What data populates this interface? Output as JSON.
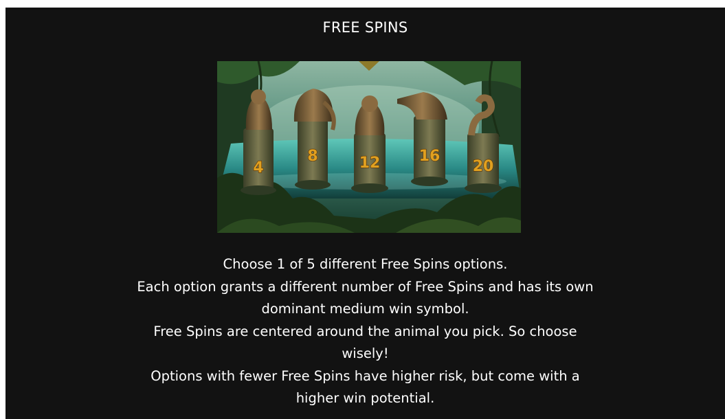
{
  "title": "FREE SPINS",
  "scene": {
    "pillars": [
      {
        "animal": "bear-statue",
        "spins": "4"
      },
      {
        "animal": "elephant-statue",
        "spins": "8"
      },
      {
        "animal": "bear-statue",
        "spins": "12"
      },
      {
        "animal": "crocodile-statue",
        "spins": "16"
      },
      {
        "animal": "snake-statue",
        "spins": "20"
      }
    ]
  },
  "description": [
    "Choose 1 of 5 different Free Spins options.",
    "Each option grants a different number of Free Spins and has its own",
    "dominant medium win symbol.",
    "Free Spins are centered around the animal you pick. So choose",
    "wisely!",
    "Options with fewer Free Spins have higher risk, but come with a",
    "higher win potential."
  ],
  "colors": {
    "background": "#121212",
    "text": "#ffffff",
    "number_gold": "#e0a020"
  }
}
